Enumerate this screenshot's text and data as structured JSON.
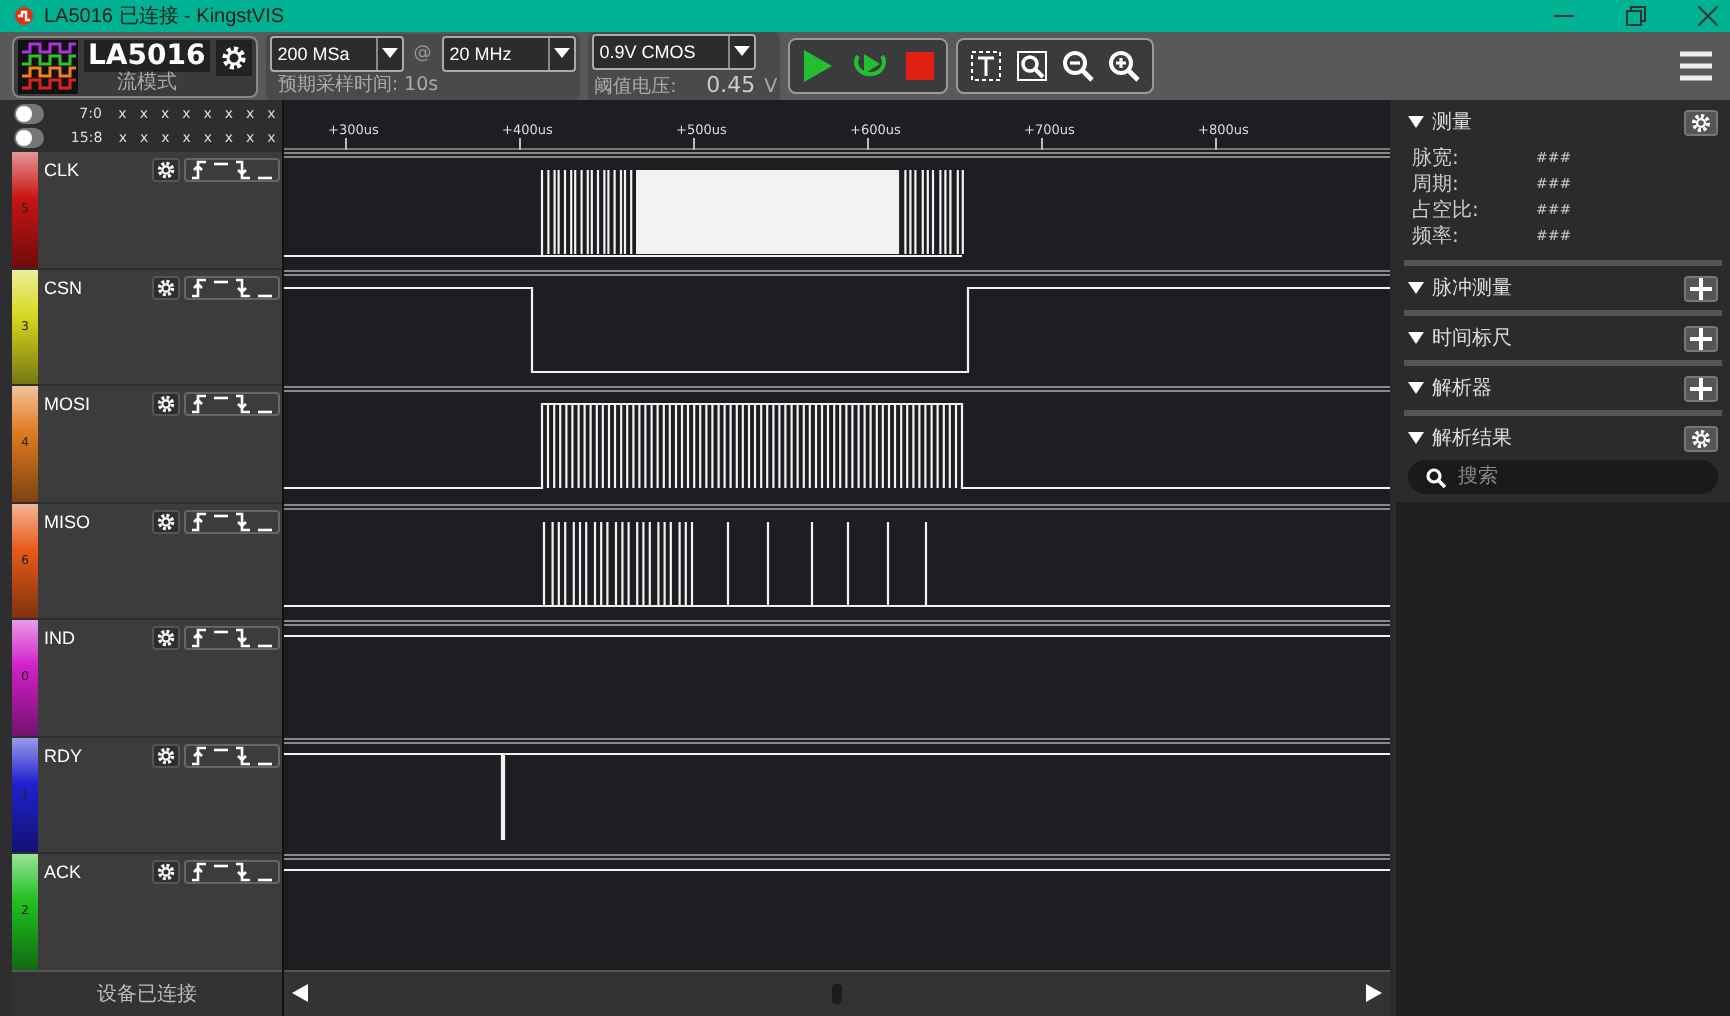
{
  "window": {
    "title": "LA5016 已连接 - KingstVIS"
  },
  "device": {
    "name": "LA5016",
    "mode": "流模式"
  },
  "sample_rate": {
    "value": "200 MSa"
  },
  "at_sign": "@",
  "frequency": {
    "value": "20 MHz"
  },
  "sample_time": "预期采样时间: 10s",
  "threshold": {
    "value": "0.9V CMOS"
  },
  "threshold_label": "阈值电压:",
  "threshold_voltage": "0.45",
  "threshold_unit": "V",
  "status_rows": [
    {
      "label": "7:0",
      "on": false,
      "bits": [
        "x",
        "x",
        "x",
        "x",
        "x",
        "x",
        "x",
        "x"
      ]
    },
    {
      "label": "15:8",
      "on": false,
      "bits": [
        "x",
        "x",
        "x",
        "x",
        "x",
        "x",
        "x",
        "x"
      ]
    }
  ],
  "ruler_ticks": [
    "+300us",
    "+400us",
    "+500us",
    "+600us",
    "+700us",
    "+800us"
  ],
  "channels": [
    {
      "name": "CLK",
      "number": "5",
      "color": "#c81414"
    },
    {
      "name": "CSN",
      "number": "3",
      "color": "#d8d820"
    },
    {
      "name": "MOSI",
      "number": "4",
      "color": "#e07a20"
    },
    {
      "name": "MISO",
      "number": "6",
      "color": "#e85a18"
    },
    {
      "name": "IND",
      "number": "0",
      "color": "#d020c8"
    },
    {
      "name": "RDY",
      "number": "1",
      "color": "#2020d0"
    },
    {
      "name": "ACK",
      "number": "2",
      "color": "#20c020"
    }
  ],
  "status_bar": "设备已连接",
  "panel": [
    {
      "title": "测量",
      "expanded": true,
      "kind": "settings",
      "items": [
        {
          "label": "脉宽:",
          "value": "###"
        },
        {
          "label": "周期:",
          "value": "###"
        },
        {
          "label": "占空比:",
          "value": "###"
        },
        {
          "label": "频率:",
          "value": "###"
        }
      ]
    },
    {
      "title": "脉冲测量",
      "expanded": true,
      "kind": "add"
    },
    {
      "title": "时间标尺",
      "expanded": true,
      "kind": "add"
    },
    {
      "title": "解析器",
      "expanded": true,
      "kind": "add"
    },
    {
      "title": "解析结果",
      "expanded": true,
      "kind": "settings",
      "search_placeholder": "搜索"
    }
  ]
}
